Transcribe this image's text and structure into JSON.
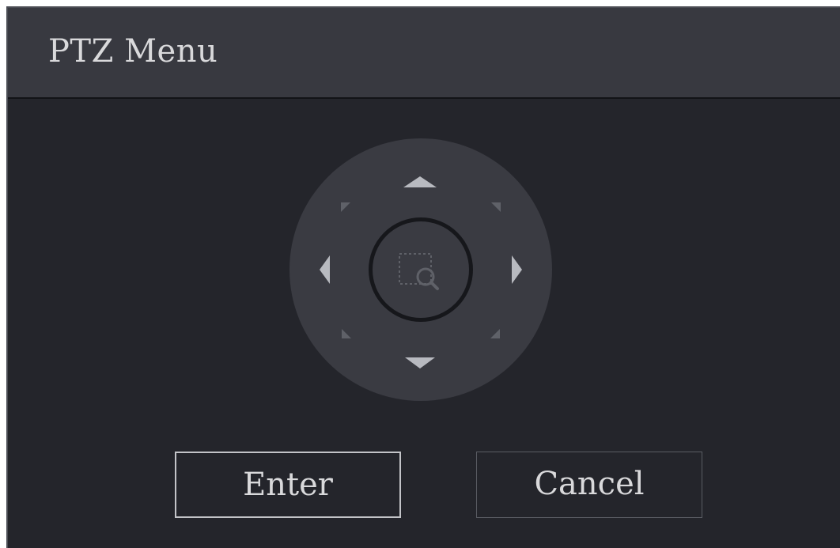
{
  "dialog": {
    "title": "PTZ Menu"
  },
  "ptz": {
    "icons": {
      "up": "arrow-up-icon",
      "down": "arrow-down-icon",
      "left": "arrow-left-icon",
      "right": "arrow-right-icon",
      "center": "zoom-magnifier-icon"
    }
  },
  "buttons": {
    "enter_label": "Enter",
    "cancel_label": "Cancel"
  },
  "colors": {
    "background": "#24252b",
    "titlebar": "#383940",
    "pad": "#3a3b42",
    "text": "#d9d9db",
    "arrow": "#b8bac0"
  }
}
